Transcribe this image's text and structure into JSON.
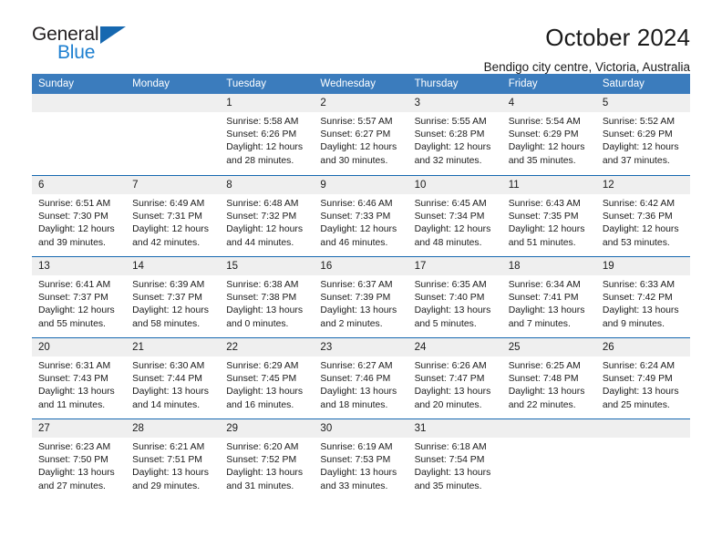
{
  "logo": {
    "word_one": "General",
    "word_two": "Blue",
    "triangle_color": "#1668b0",
    "blue_color": "#1d7fd0"
  },
  "header": {
    "title": "October 2024",
    "subtitle": "Bendigo city centre, Victoria, Australia"
  },
  "theme": {
    "header_blue": "#3b7cbd",
    "rule_blue": "#1668b0",
    "daynum_gray": "#efefef"
  },
  "calendar": {
    "weekdays": [
      "Sunday",
      "Monday",
      "Tuesday",
      "Wednesday",
      "Thursday",
      "Friday",
      "Saturday"
    ],
    "weeks": [
      [
        {
          "day": "",
          "sunrise": "",
          "sunset": "",
          "daylight": "",
          "empty": true
        },
        {
          "day": "",
          "sunrise": "",
          "sunset": "",
          "daylight": "",
          "empty": true
        },
        {
          "day": "1",
          "sunrise": "Sunrise: 5:58 AM",
          "sunset": "Sunset: 6:26 PM",
          "daylight": "Daylight: 12 hours and 28 minutes."
        },
        {
          "day": "2",
          "sunrise": "Sunrise: 5:57 AM",
          "sunset": "Sunset: 6:27 PM",
          "daylight": "Daylight: 12 hours and 30 minutes."
        },
        {
          "day": "3",
          "sunrise": "Sunrise: 5:55 AM",
          "sunset": "Sunset: 6:28 PM",
          "daylight": "Daylight: 12 hours and 32 minutes."
        },
        {
          "day": "4",
          "sunrise": "Sunrise: 5:54 AM",
          "sunset": "Sunset: 6:29 PM",
          "daylight": "Daylight: 12 hours and 35 minutes."
        },
        {
          "day": "5",
          "sunrise": "Sunrise: 5:52 AM",
          "sunset": "Sunset: 6:29 PM",
          "daylight": "Daylight: 12 hours and 37 minutes."
        }
      ],
      [
        {
          "day": "6",
          "sunrise": "Sunrise: 6:51 AM",
          "sunset": "Sunset: 7:30 PM",
          "daylight": "Daylight: 12 hours and 39 minutes."
        },
        {
          "day": "7",
          "sunrise": "Sunrise: 6:49 AM",
          "sunset": "Sunset: 7:31 PM",
          "daylight": "Daylight: 12 hours and 42 minutes."
        },
        {
          "day": "8",
          "sunrise": "Sunrise: 6:48 AM",
          "sunset": "Sunset: 7:32 PM",
          "daylight": "Daylight: 12 hours and 44 minutes."
        },
        {
          "day": "9",
          "sunrise": "Sunrise: 6:46 AM",
          "sunset": "Sunset: 7:33 PM",
          "daylight": "Daylight: 12 hours and 46 minutes."
        },
        {
          "day": "10",
          "sunrise": "Sunrise: 6:45 AM",
          "sunset": "Sunset: 7:34 PM",
          "daylight": "Daylight: 12 hours and 48 minutes."
        },
        {
          "day": "11",
          "sunrise": "Sunrise: 6:43 AM",
          "sunset": "Sunset: 7:35 PM",
          "daylight": "Daylight: 12 hours and 51 minutes."
        },
        {
          "day": "12",
          "sunrise": "Sunrise: 6:42 AM",
          "sunset": "Sunset: 7:36 PM",
          "daylight": "Daylight: 12 hours and 53 minutes."
        }
      ],
      [
        {
          "day": "13",
          "sunrise": "Sunrise: 6:41 AM",
          "sunset": "Sunset: 7:37 PM",
          "daylight": "Daylight: 12 hours and 55 minutes."
        },
        {
          "day": "14",
          "sunrise": "Sunrise: 6:39 AM",
          "sunset": "Sunset: 7:37 PM",
          "daylight": "Daylight: 12 hours and 58 minutes."
        },
        {
          "day": "15",
          "sunrise": "Sunrise: 6:38 AM",
          "sunset": "Sunset: 7:38 PM",
          "daylight": "Daylight: 13 hours and 0 minutes."
        },
        {
          "day": "16",
          "sunrise": "Sunrise: 6:37 AM",
          "sunset": "Sunset: 7:39 PM",
          "daylight": "Daylight: 13 hours and 2 minutes."
        },
        {
          "day": "17",
          "sunrise": "Sunrise: 6:35 AM",
          "sunset": "Sunset: 7:40 PM",
          "daylight": "Daylight: 13 hours and 5 minutes."
        },
        {
          "day": "18",
          "sunrise": "Sunrise: 6:34 AM",
          "sunset": "Sunset: 7:41 PM",
          "daylight": "Daylight: 13 hours and 7 minutes."
        },
        {
          "day": "19",
          "sunrise": "Sunrise: 6:33 AM",
          "sunset": "Sunset: 7:42 PM",
          "daylight": "Daylight: 13 hours and 9 minutes."
        }
      ],
      [
        {
          "day": "20",
          "sunrise": "Sunrise: 6:31 AM",
          "sunset": "Sunset: 7:43 PM",
          "daylight": "Daylight: 13 hours and 11 minutes."
        },
        {
          "day": "21",
          "sunrise": "Sunrise: 6:30 AM",
          "sunset": "Sunset: 7:44 PM",
          "daylight": "Daylight: 13 hours and 14 minutes."
        },
        {
          "day": "22",
          "sunrise": "Sunrise: 6:29 AM",
          "sunset": "Sunset: 7:45 PM",
          "daylight": "Daylight: 13 hours and 16 minutes."
        },
        {
          "day": "23",
          "sunrise": "Sunrise: 6:27 AM",
          "sunset": "Sunset: 7:46 PM",
          "daylight": "Daylight: 13 hours and 18 minutes."
        },
        {
          "day": "24",
          "sunrise": "Sunrise: 6:26 AM",
          "sunset": "Sunset: 7:47 PM",
          "daylight": "Daylight: 13 hours and 20 minutes."
        },
        {
          "day": "25",
          "sunrise": "Sunrise: 6:25 AM",
          "sunset": "Sunset: 7:48 PM",
          "daylight": "Daylight: 13 hours and 22 minutes."
        },
        {
          "day": "26",
          "sunrise": "Sunrise: 6:24 AM",
          "sunset": "Sunset: 7:49 PM",
          "daylight": "Daylight: 13 hours and 25 minutes."
        }
      ],
      [
        {
          "day": "27",
          "sunrise": "Sunrise: 6:23 AM",
          "sunset": "Sunset: 7:50 PM",
          "daylight": "Daylight: 13 hours and 27 minutes."
        },
        {
          "day": "28",
          "sunrise": "Sunrise: 6:21 AM",
          "sunset": "Sunset: 7:51 PM",
          "daylight": "Daylight: 13 hours and 29 minutes."
        },
        {
          "day": "29",
          "sunrise": "Sunrise: 6:20 AM",
          "sunset": "Sunset: 7:52 PM",
          "daylight": "Daylight: 13 hours and 31 minutes."
        },
        {
          "day": "30",
          "sunrise": "Sunrise: 6:19 AM",
          "sunset": "Sunset: 7:53 PM",
          "daylight": "Daylight: 13 hours and 33 minutes."
        },
        {
          "day": "31",
          "sunrise": "Sunrise: 6:18 AM",
          "sunset": "Sunset: 7:54 PM",
          "daylight": "Daylight: 13 hours and 35 minutes."
        },
        {
          "day": "",
          "sunrise": "",
          "sunset": "",
          "daylight": "",
          "empty": true
        },
        {
          "day": "",
          "sunrise": "",
          "sunset": "",
          "daylight": "",
          "empty": true
        }
      ]
    ]
  }
}
